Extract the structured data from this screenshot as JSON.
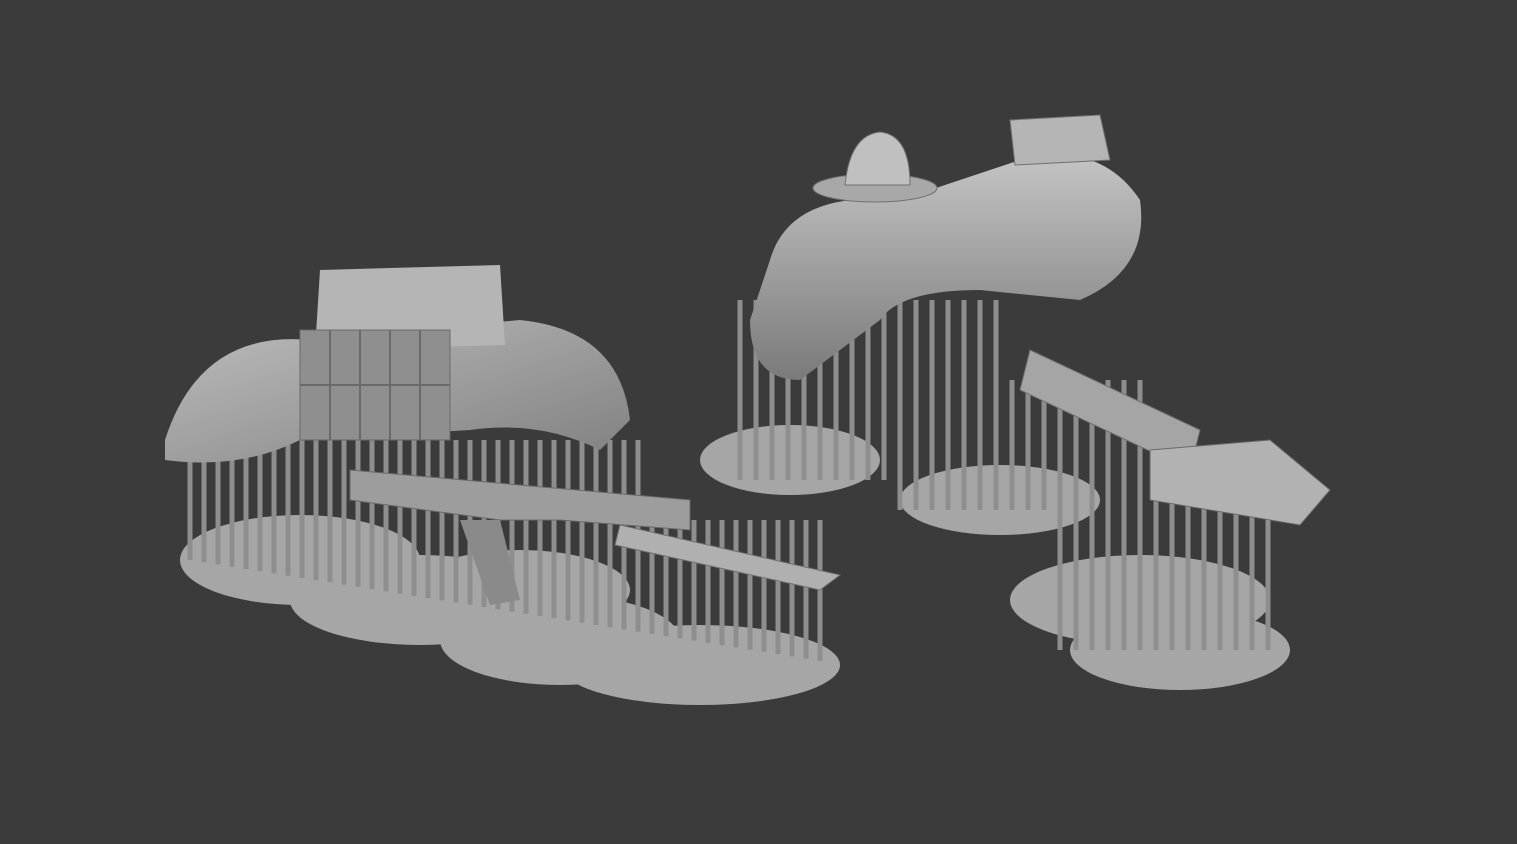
{
  "colors": {
    "background": "#3b3b3c",
    "model": "#9a9a9a",
    "model_light": "#b8b8b8",
    "model_dark": "#6e6e6e",
    "base_plate": "#a9a9a9"
  }
}
